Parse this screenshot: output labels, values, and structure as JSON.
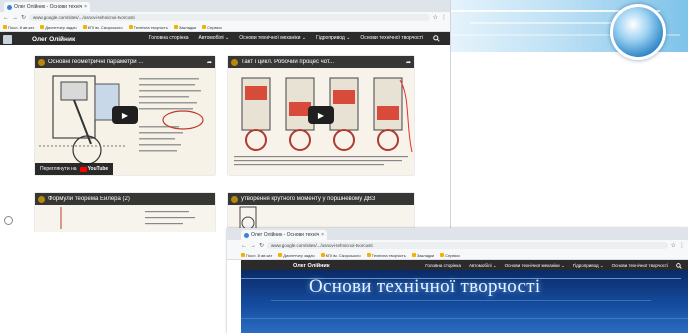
{
  "main_window": {
    "tab": {
      "title": "Олег Олійник - Основи технічної творчості",
      "close": "×"
    },
    "address": {
      "url": "www.google.com/sites/.../osnovi-tehnicnoi-tvorcosti"
    },
    "bookmarks": [
      {
        "label": "Посл. й ав кат"
      },
      {
        "label": "Диспетчер задач"
      },
      {
        "label": "КПІ ім. Сікорського"
      },
      {
        "label": "Технічна творчість"
      },
      {
        "label": "Закладки"
      },
      {
        "label": "Сервіси"
      }
    ]
  },
  "site": {
    "title": "Олег Олійник",
    "menu": [
      {
        "label": "Головна сторінка",
        "caret": ""
      },
      {
        "label": "Автомобілі",
        "caret": "⌄"
      },
      {
        "label": "Основи технічної механіки",
        "caret": "⌄"
      },
      {
        "label": "Гідропривод",
        "caret": "⌄"
      },
      {
        "label": "Основи технічної творчості",
        "caret": ""
      }
    ],
    "search_icon": "search-icon"
  },
  "videos": [
    {
      "title": "Основні геометричні параметри ...",
      "watch_label": "Переглянути на",
      "youtube_label": "YouTube",
      "share": "➦"
    },
    {
      "title": "Такт і цикл. Робочий процес чот...",
      "share": "➦"
    },
    {
      "title": "Формули теорема Ейлера (2)"
    },
    {
      "title": "утворення крутного моменту у поршневому ДВЗ"
    }
  ],
  "second_window": {
    "tab": {
      "title": "Олег Олійник - Основи технічної творчості",
      "close": "×"
    },
    "address": {
      "url": "www.google.com/sites/.../osnovi-tehnicnoi-tvorcosti"
    },
    "bookmarks": [
      {
        "label": "Посл. й ав кат"
      },
      {
        "label": "Диспетчер задач"
      },
      {
        "label": "КПІ ім. Сікорського"
      },
      {
        "label": "Технічна творчість"
      },
      {
        "label": "Закладки"
      },
      {
        "label": "Сервіси"
      }
    ],
    "hero_title": "Основи технічної творчості"
  },
  "colors": {
    "nav_bg": "#2b2b2b",
    "hero_blue": "#154c9e",
    "accent": "#3b82d6"
  }
}
